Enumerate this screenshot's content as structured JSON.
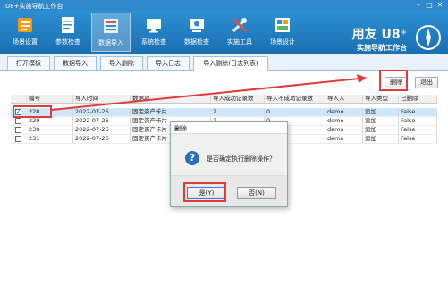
{
  "window": {
    "title": "U8+实施导航工作台"
  },
  "ribbon": {
    "items": [
      {
        "label": "场景设置",
        "icon": "scene-settings-icon"
      },
      {
        "label": "参数检查",
        "icon": "parameter-check-icon"
      },
      {
        "label": "数据导入",
        "icon": "data-import-icon"
      },
      {
        "label": "系统检查",
        "icon": "system-check-icon"
      },
      {
        "label": "数据检查",
        "icon": "data-check-icon"
      },
      {
        "label": "实施工具",
        "icon": "tools-icon"
      },
      {
        "label": "场景设计",
        "icon": "scene-design-icon"
      }
    ],
    "brand_line1": "用友 U8⁺",
    "brand_line2": "实施导航工作台"
  },
  "tabs": [
    {
      "label": "打开模板"
    },
    {
      "label": "数据导入"
    },
    {
      "label": "导入删除"
    },
    {
      "label": "导入日志"
    },
    {
      "label": "导入删除(日志列表)"
    }
  ],
  "toolbar": {
    "delete_label": "删除",
    "exit_label": "退出"
  },
  "grid": {
    "columns": [
      "编号",
      "导入时间",
      "数据项",
      "导入成功记录数",
      "导入不成功记录数",
      "导入人",
      "导入类型",
      "已删除"
    ],
    "rows": [
      {
        "checked": true,
        "id": "228",
        "time": "2022-07-26",
        "item": "固定资产卡片",
        "ok": "2",
        "fail": "0",
        "user": "demo",
        "type": "追加",
        "deleted": "False"
      },
      {
        "checked": false,
        "id": "229",
        "time": "2022-07-26",
        "item": "固定资产卡片",
        "ok": "2",
        "fail": "0",
        "user": "demo",
        "type": "追加",
        "deleted": "False"
      },
      {
        "checked": false,
        "id": "230",
        "time": "2022-07-26",
        "item": "固定资产卡片",
        "ok": "2",
        "fail": "0",
        "user": "demo",
        "type": "追加",
        "deleted": "False"
      },
      {
        "checked": false,
        "id": "231",
        "time": "2022-07-26",
        "item": "固定资产卡片",
        "ok": "2",
        "fail": "0",
        "user": "demo",
        "type": "追加",
        "deleted": "False"
      }
    ]
  },
  "dialog": {
    "title": "删除",
    "message": "是否确定执行删除操作？",
    "yes_label": "是(Y)",
    "no_label": "否(N)"
  },
  "colors": {
    "accent": "#2c8fd3",
    "highlight": "#e23a3a",
    "selected_row": "#cfe6fb"
  }
}
